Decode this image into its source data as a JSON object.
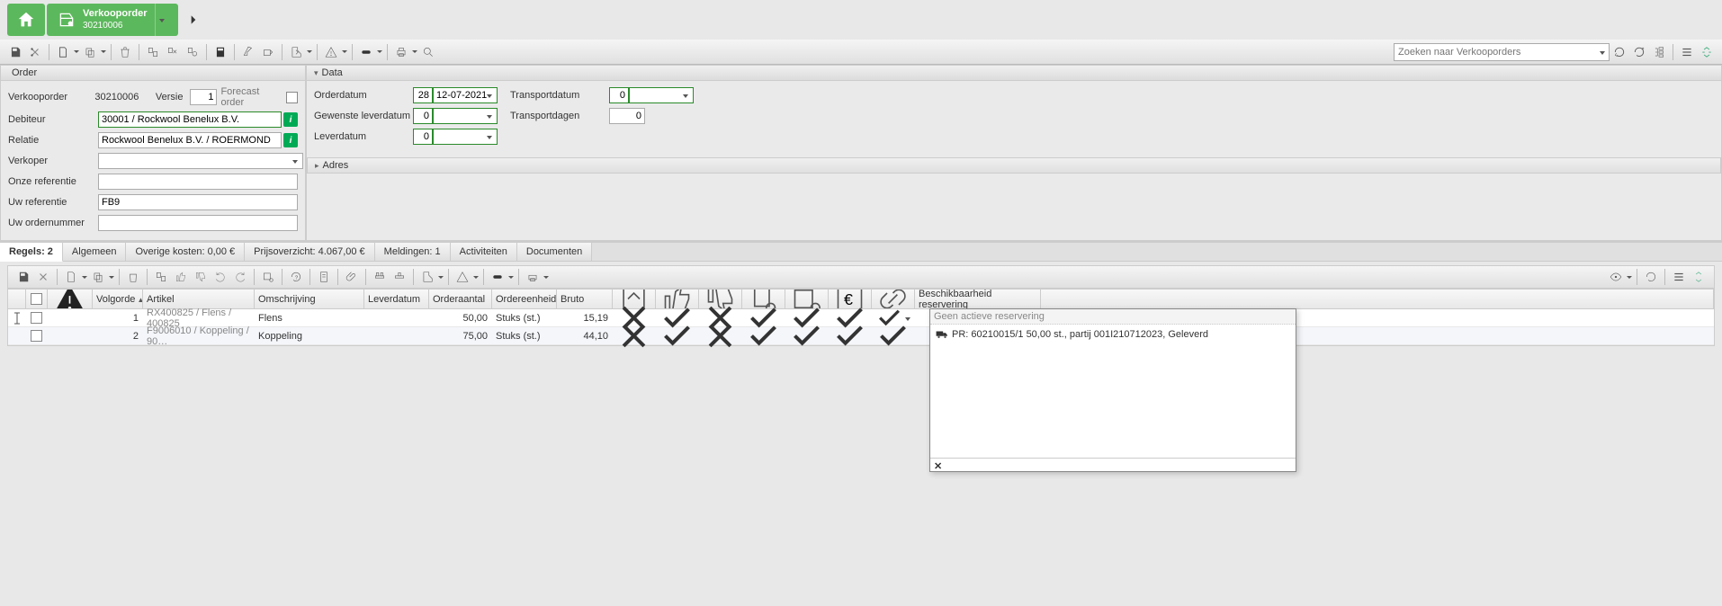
{
  "breadcrumb": {
    "title": "Verkooporder",
    "sub": "30210006"
  },
  "search_placeholder": "Zoeken naar Verkooporders",
  "panel_order": {
    "title": "Order",
    "labels": {
      "verkooporder": "Verkooporder",
      "versie": "Versie",
      "forecast": "Forecast order",
      "debiteur": "Debiteur",
      "relatie": "Relatie",
      "verkoper": "Verkoper",
      "onze_ref": "Onze referentie",
      "uw_ref": "Uw referentie",
      "uw_ordnr": "Uw ordernummer"
    },
    "values": {
      "verkooporder": "30210006",
      "versie": "1",
      "debiteur": "30001 / Rockwool Benelux B.V.",
      "relatie": "Rockwool Benelux B.V. / ROERMOND",
      "uw_ref": "FB9"
    }
  },
  "panel_data": {
    "title": "Data",
    "labels": {
      "orderdatum": "Orderdatum",
      "gewenste": "Gewenste leverdatum",
      "leverdatum": "Leverdatum",
      "transportdatum": "Transportdatum",
      "transportdagen": "Transportdagen"
    },
    "values": {
      "order_wk": "28",
      "order_date": "12-07-2021",
      "gewenste": "0",
      "leverdatum": "0",
      "transportdatum": "0",
      "transportdagen": "0"
    }
  },
  "panel_adres": {
    "title": "Adres"
  },
  "tabs": [
    {
      "label": "Regels: 2",
      "active": true
    },
    {
      "label": "Algemeen"
    },
    {
      "label": "Overige kosten: 0,00 €"
    },
    {
      "label": "Prijsoverzicht: 4.067,00 €"
    },
    {
      "label": "Meldingen: 1"
    },
    {
      "label": "Activiteiten"
    },
    {
      "label": "Documenten"
    }
  ],
  "grid": {
    "headers": {
      "volgorde": "Volgorde",
      "artikel": "Artikel",
      "omschrijving": "Omschrijving",
      "leverdatum": "Leverdatum",
      "orderaantal": "Orderaantal",
      "ordereenheid": "Ordereenheid",
      "bruto": "Bruto",
      "beschikbaarheid": "Beschikbaarheid reservering"
    },
    "rows": [
      {
        "idx": "",
        "volgorde": "1",
        "artikel": "RX400825 / Flens / 400825",
        "oms": "Flens",
        "lev": "",
        "qty": "50,00",
        "unit": "Stuks (st.)",
        "bruto": "15,19",
        "ic": [
          "x",
          "check",
          "x",
          "check",
          "check",
          "check",
          "check"
        ]
      },
      {
        "idx": "",
        "volgorde": "2",
        "artikel": "F9006010 / Koppeling / 90…",
        "oms": "Koppeling",
        "lev": "",
        "qty": "75,00",
        "unit": "Stuks (st.)",
        "bruto": "44,10",
        "ic": [
          "x",
          "check",
          "x",
          "check",
          "check",
          "check",
          "check"
        ]
      }
    ]
  },
  "popup": {
    "head": "Geen actieve reservering",
    "row": "PR: 60210015/1 50,00 st., partij 001I210712023, Geleverd",
    "close": "✕"
  }
}
